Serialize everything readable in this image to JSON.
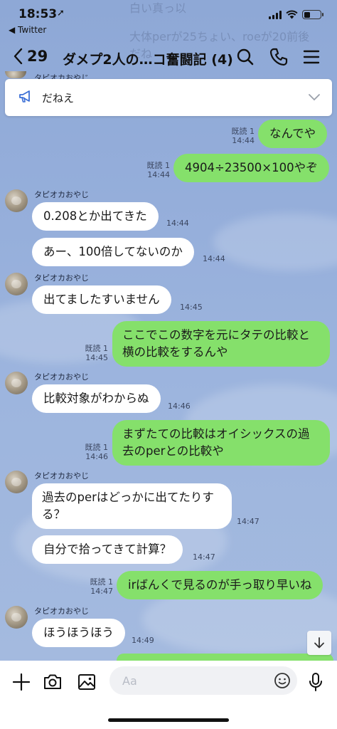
{
  "status": {
    "time": "18:53",
    "back_app": "◀ Twitter"
  },
  "ghost": {
    "line1": "白い真っ以",
    "line2": "大体perが25ちょい、roeが20前後",
    "line3": "だね"
  },
  "header": {
    "back_count": "29",
    "title": "ダメプ2人の…コ奮闘記 (4)"
  },
  "announcement": {
    "text": "だねえ"
  },
  "messages": {
    "m1": {
      "text": "なんでや",
      "read": "既読 1",
      "time": "14:44"
    },
    "m2": {
      "text": "4904÷23500×100やぞ",
      "read": "既読 1",
      "time": "14:44"
    },
    "m3": {
      "sender": "タピオカおやじ",
      "text": "0.208とか出てきた",
      "time": "14:44"
    },
    "m4": {
      "text": "あー、100倍してないのか",
      "time": "14:44"
    },
    "m5": {
      "sender": "タピオカおやじ",
      "text": "出てましたすいません",
      "time": "14:45"
    },
    "m6": {
      "line1": "ここでこの数字を元にタテの比較と",
      "line2": "横の比較をするんや",
      "read": "既読 1",
      "time": "14:45"
    },
    "m7": {
      "sender": "タピオカおやじ",
      "text": "比較対象がわからぬ",
      "time": "14:46"
    },
    "m8": {
      "line1": "まずたての比較はオイシックスの過",
      "line2": "去のperとの比較や",
      "read": "既読 1",
      "time": "14:46"
    },
    "m9": {
      "sender": "タピオカおやじ",
      "line1": "過去のperはどっかに出てたりす",
      "line2": "る？",
      "time": "14:47"
    },
    "m10": {
      "text": "自分で拾ってきて計算？",
      "time": "14:47"
    },
    "m11": {
      "text": "irばんくで見るのが手っ取り早いね",
      "read": "既読 1",
      "time": "14:47"
    },
    "m12": {
      "sender": "タピオカおやじ",
      "text": "ほうほうほう",
      "time": "14:49"
    },
    "top_sender": "タピオカおやじ"
  },
  "input": {
    "placeholder": "Aa"
  },
  "colors": {
    "outgoing": "#85e06b",
    "incoming": "#ffffff",
    "background": "#94acd9"
  }
}
